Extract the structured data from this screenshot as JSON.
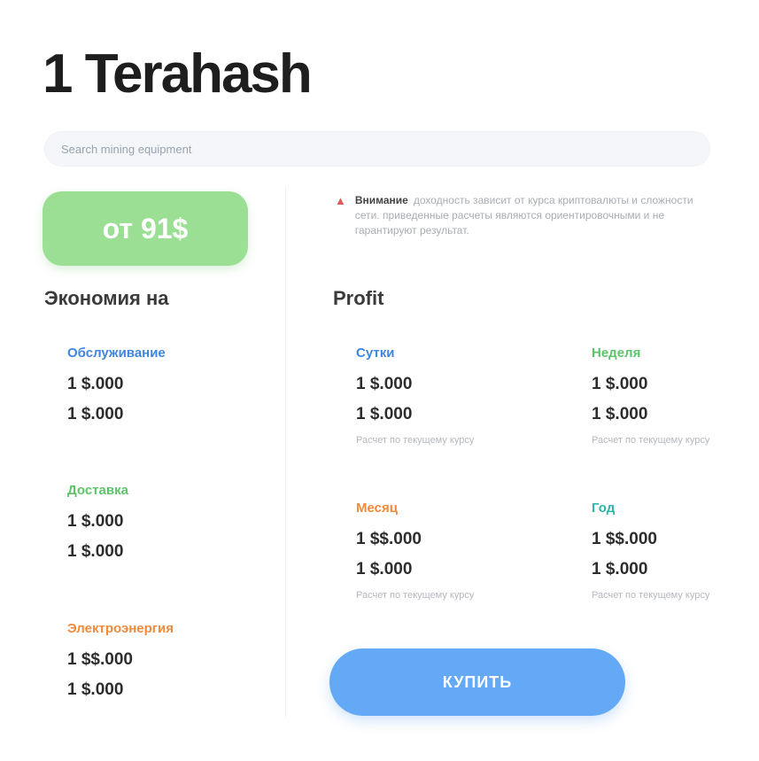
{
  "title": "1 Terahash",
  "search": {
    "placeholder": "Search mining equipment"
  },
  "price_button": {
    "label": "от 91$"
  },
  "colors": {
    "green": "#9adf93",
    "blue": "#63a9f5",
    "label_blue": "#3f86e0",
    "label_green": "#5cc56a",
    "label_orange": "#f08a3c",
    "label_teal": "#2db5a9",
    "warning_red": "#e25b5b"
  },
  "left": {
    "heading": "Экономия на",
    "blocks": [
      {
        "label": "Обслуживание",
        "color": "#3f86e0",
        "rows": [
          "1 $.000",
          "1 $.000"
        ]
      },
      {
        "label": "Доставка",
        "color": "#5cc56a",
        "rows": [
          "1 $.000",
          "1 $.000"
        ]
      },
      {
        "label": "Электроэнергия",
        "color": "#f08a3c",
        "rows": [
          "1 $$.000",
          "1 $.000"
        ]
      }
    ]
  },
  "warning": {
    "title": "Внимание",
    "text": "доходность зависит от курса криптовалюты и сложности сети. приведенные расчеты являются ориентировочными и не гарантируют результат."
  },
  "right": {
    "heading": "Profit",
    "blocks": [
      {
        "label": "Сутки",
        "color": "#3f86e0",
        "rows": [
          "1 $.000",
          "1 $.000"
        ],
        "note": "Расчет по текущему курсу"
      },
      {
        "label": "Неделя",
        "color": "#5cc56a",
        "rows": [
          "1 $.000",
          "1 $.000"
        ],
        "note": "Расчет по текущему курсу"
      },
      {
        "label": "Месяц",
        "color": "#f08a3c",
        "rows": [
          "1 $$.000",
          "1 $.000"
        ],
        "note": "Расчет по текущему курсу"
      },
      {
        "label": "Год",
        "color": "#2db5a9",
        "rows": [
          "1 $$.000",
          "1 $.000"
        ],
        "note": "Расчет по текущему курсу"
      }
    ]
  },
  "buy_button": {
    "label": "КУПИТЬ"
  }
}
